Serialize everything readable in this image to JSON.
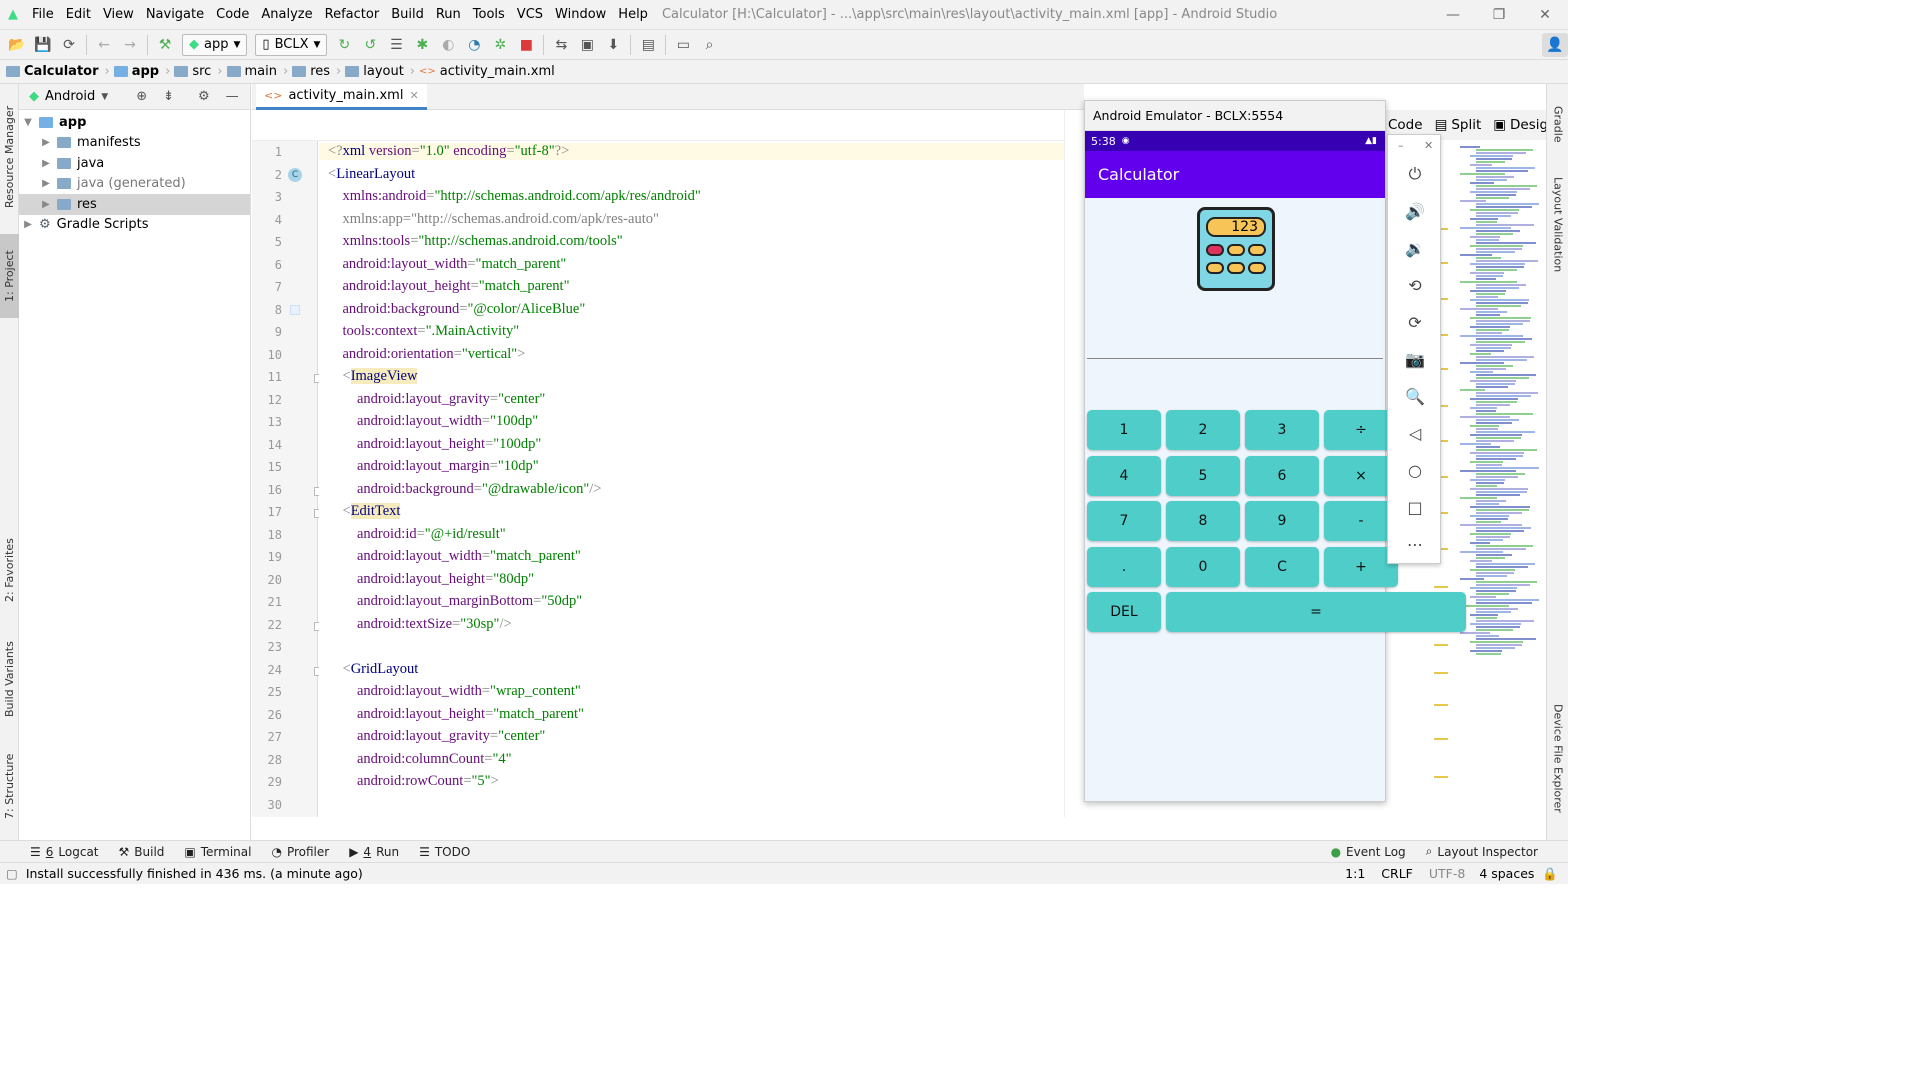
{
  "menu": {
    "items": [
      "File",
      "Edit",
      "View",
      "Navigate",
      "Code",
      "Analyze",
      "Refactor",
      "Build",
      "Run",
      "Tools",
      "VCS",
      "Window",
      "Help"
    ],
    "window_title": "Calculator [H:\\Calculator] - ...\\app\\src\\main\\res\\layout\\activity_main.xml [app] - Android Studio"
  },
  "toolbar": {
    "config_label": "app",
    "device_label": "BCLX"
  },
  "breadcrumb": [
    "Calculator",
    "app",
    "src",
    "main",
    "res",
    "layout",
    "activity_main.xml"
  ],
  "project": {
    "view_label": "Android",
    "tree": [
      {
        "label": "app",
        "bold": true
      },
      {
        "label": "manifests"
      },
      {
        "label": "java"
      },
      {
        "label": "java (generated)"
      },
      {
        "label": "res"
      },
      {
        "label": "Gradle Scripts"
      }
    ]
  },
  "left_tabs": {
    "resource_manager": "Resource Manager",
    "project": "1: Project",
    "favorites": "2: Favorites",
    "build_variants": "Build Variants",
    "structure": "7: Structure"
  },
  "editor": {
    "tab": "activity_main.xml",
    "gutter_marker": "C",
    "lines": [
      [
        [
          "br",
          "<?"
        ],
        [
          "tag",
          "xml "
        ],
        [
          "attr",
          "version"
        ],
        [
          "br",
          "="
        ],
        [
          "val",
          "\"1.0\""
        ],
        [
          "br",
          " "
        ],
        [
          "attr",
          "encoding"
        ],
        [
          "br",
          "="
        ],
        [
          "val",
          "\"utf-8\""
        ],
        [
          "br",
          "?>"
        ]
      ],
      [
        [
          "br",
          "<"
        ],
        [
          "tag",
          "LinearLayout"
        ]
      ],
      [
        [
          "t",
          "    "
        ],
        [
          "attr",
          "xmlns:android"
        ],
        [
          "br",
          "="
        ],
        [
          "val",
          "\"http://schemas.android.com/apk/res/android\""
        ]
      ],
      [
        [
          "t",
          "    "
        ],
        [
          "gray",
          "xmlns:app=\"http://schemas.android.com/apk/res-auto\""
        ]
      ],
      [
        [
          "t",
          "    "
        ],
        [
          "attr",
          "xmlns:tools"
        ],
        [
          "br",
          "="
        ],
        [
          "val",
          "\"http://schemas.android.com/tools\""
        ]
      ],
      [
        [
          "t",
          "    "
        ],
        [
          "attr",
          "android:layout_width"
        ],
        [
          "br",
          "="
        ],
        [
          "val",
          "\"match_parent\""
        ]
      ],
      [
        [
          "t",
          "    "
        ],
        [
          "attr",
          "android:layout_height"
        ],
        [
          "br",
          "="
        ],
        [
          "val",
          "\"match_parent\""
        ]
      ],
      [
        [
          "t",
          "    "
        ],
        [
          "attr",
          "android:background"
        ],
        [
          "br",
          "="
        ],
        [
          "val",
          "\"@color/AliceBlue\""
        ]
      ],
      [
        [
          "t",
          "    "
        ],
        [
          "attr",
          "tools:context"
        ],
        [
          "br",
          "="
        ],
        [
          "val",
          "\".MainActivity\""
        ]
      ],
      [
        [
          "t",
          "    "
        ],
        [
          "attr",
          "android:orientation"
        ],
        [
          "br",
          "="
        ],
        [
          "val",
          "\"vertical\""
        ],
        [
          "br",
          ">"
        ]
      ],
      [
        [
          "t",
          "    "
        ],
        [
          "br",
          "<"
        ],
        [
          "tag",
          "ImageView"
        ]
      ],
      [
        [
          "t",
          "        "
        ],
        [
          "attr",
          "android:layout_gravity"
        ],
        [
          "br",
          "="
        ],
        [
          "val",
          "\"center\""
        ]
      ],
      [
        [
          "t",
          "        "
        ],
        [
          "attr",
          "android:layout_width"
        ],
        [
          "br",
          "="
        ],
        [
          "val",
          "\"100dp\""
        ]
      ],
      [
        [
          "t",
          "        "
        ],
        [
          "attr",
          "android:layout_height"
        ],
        [
          "br",
          "="
        ],
        [
          "val",
          "\"100dp\""
        ]
      ],
      [
        [
          "t",
          "        "
        ],
        [
          "attr",
          "android:layout_margin"
        ],
        [
          "br",
          "="
        ],
        [
          "val",
          "\"10dp\""
        ]
      ],
      [
        [
          "t",
          "        "
        ],
        [
          "attr",
          "android:background"
        ],
        [
          "br",
          "="
        ],
        [
          "val",
          "\"@drawable/icon\""
        ],
        [
          "br",
          "/>"
        ]
      ],
      [
        [
          "t",
          "    "
        ],
        [
          "br",
          "<"
        ],
        [
          "tag",
          "EditText"
        ]
      ],
      [
        [
          "t",
          "        "
        ],
        [
          "attr",
          "android:id"
        ],
        [
          "br",
          "="
        ],
        [
          "val",
          "\"@+id/result\""
        ]
      ],
      [
        [
          "t",
          "        "
        ],
        [
          "attr",
          "android:layout_width"
        ],
        [
          "br",
          "="
        ],
        [
          "val",
          "\"match_parent\""
        ]
      ],
      [
        [
          "t",
          "        "
        ],
        [
          "attr",
          "android:layout_height"
        ],
        [
          "br",
          "="
        ],
        [
          "val",
          "\"80dp\""
        ]
      ],
      [
        [
          "t",
          "        "
        ],
        [
          "attr",
          "android:layout_marginBottom"
        ],
        [
          "br",
          "="
        ],
        [
          "val",
          "\"50dp\""
        ]
      ],
      [
        [
          "t",
          "        "
        ],
        [
          "attr",
          "android:textSize"
        ],
        [
          "br",
          "="
        ],
        [
          "val",
          "\"30sp\""
        ],
        [
          "br",
          "/>"
        ]
      ],
      [],
      [
        [
          "t",
          "    "
        ],
        [
          "br",
          "<"
        ],
        [
          "tag",
          "GridLayout"
        ]
      ],
      [
        [
          "t",
          "        "
        ],
        [
          "attr",
          "android:layout_width"
        ],
        [
          "br",
          "="
        ],
        [
          "val",
          "\"wrap_content\""
        ]
      ],
      [
        [
          "t",
          "        "
        ],
        [
          "attr",
          "android:layout_height"
        ],
        [
          "br",
          "="
        ],
        [
          "val",
          "\"match_parent\""
        ]
      ],
      [
        [
          "t",
          "        "
        ],
        [
          "attr",
          "android:layout_gravity"
        ],
        [
          "br",
          "="
        ],
        [
          "val",
          "\"center\""
        ]
      ],
      [
        [
          "t",
          "        "
        ],
        [
          "attr",
          "android:columnCount"
        ],
        [
          "br",
          "="
        ],
        [
          "val",
          "\"4\""
        ]
      ],
      [
        [
          "t",
          "        "
        ],
        [
          "attr",
          "android:rowCount"
        ],
        [
          "br",
          "="
        ],
        [
          "val",
          "\"5\""
        ],
        [
          "br",
          ">"
        ]
      ],
      []
    ]
  },
  "design_tabs": {
    "code": "Code",
    "split": "Split",
    "design": "Design"
  },
  "emulator": {
    "title": "Android Emulator - BCLX:5554",
    "time": "5:38",
    "app_title": "Calculator",
    "icon_display": "123",
    "buttons": [
      [
        "1",
        "2",
        "3",
        "÷"
      ],
      [
        "4",
        "5",
        "6",
        "×"
      ],
      [
        "7",
        "8",
        "9",
        "-"
      ],
      [
        ".",
        "0",
        "C",
        "+"
      ],
      [
        "DEL",
        "="
      ]
    ],
    "side_icons": [
      "power-icon",
      "volume-up-icon",
      "volume-down-icon",
      "rotate-left-icon",
      "rotate-right-icon",
      "camera-icon",
      "zoom-icon",
      "back-icon",
      "home-icon",
      "overview-icon",
      "more-icon"
    ]
  },
  "right_tabs": {
    "gradle": "Gradle",
    "layout_validation": "Layout Validation",
    "device_file_explorer": "Device File Explorer"
  },
  "bottom_tabs": {
    "logcat_num": "6",
    "logcat": "Logcat",
    "build": "Build",
    "terminal": "Terminal",
    "profiler": "Profiler",
    "run_num": "4",
    "run": "Run",
    "todo": "TODO",
    "event_log": "Event Log",
    "layout_inspector": "Layout Inspector"
  },
  "status": {
    "message": "Install successfully finished in 436 ms. (a minute ago)",
    "position": "1:1",
    "line_sep": "CRLF",
    "encoding": "UTF-8",
    "indent": "4 spaces"
  },
  "colors": {
    "emulator_status": "#3700b3",
    "app_bar": "#6200ee",
    "calc_button": "#4ecdc9"
  }
}
